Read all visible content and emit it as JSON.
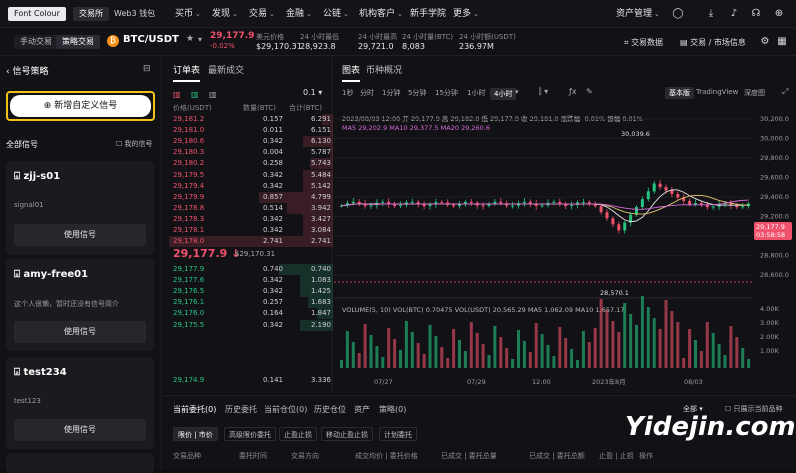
{
  "topbar": {
    "logo": "Font Colour",
    "seg_exchange": "交易所",
    "seg_wallet": "Web3 钱包",
    "nav": [
      "买币",
      "发现",
      "交易",
      "金融",
      "公链",
      "机构客户",
      "新手学院",
      "更多"
    ],
    "asset_mgmt": "资产管理"
  },
  "subbar": {
    "manual": "手动交易",
    "strategy": "策略交易",
    "pair": "BTC/USDT",
    "price": "29,177.9",
    "change": "-0.02%",
    "usd_label": "美元价格",
    "usd_value": "$29,170.31",
    "high_label": "24 小时最低",
    "high_value": "28,923.8",
    "low_label": "24 小时最高",
    "low_value": "29,721.0",
    "vol_label": "24 小时量(BTC)",
    "vol_value": "8,083",
    "amt_label": "24 小时额(USDT)",
    "amt_value": "236.97M",
    "trade_data": "交易数据",
    "trade_info": "交易 / 市场信息"
  },
  "left": {
    "title": "信号策略",
    "add": "新增自定义信号",
    "all": "全部信号",
    "mine": "我的信号",
    "cards": [
      {
        "name": "zjj-s01",
        "desc": "signal01",
        "use": "使用信号"
      },
      {
        "name": "amy-free01",
        "desc": "这个人很懒，暂时还没有信号简介",
        "use": "使用信号"
      },
      {
        "name": "test234",
        "desc": "test123",
        "use": "使用信号"
      }
    ]
  },
  "orderbook": {
    "tab_book": "订单表",
    "tab_trades": "最新成交",
    "precision": "0.1",
    "hdr_price": "价格(USDT)",
    "hdr_qty": "数量(BTC)",
    "hdr_total": "合计(BTC)",
    "asks": [
      [
        "29,181.2",
        "0.157",
        "6.291",
        0.07
      ],
      [
        "29,181.0",
        "0.011",
        "6.151",
        0.02
      ],
      [
        "29,180.6",
        "0.342",
        "6.130",
        0.18
      ],
      [
        "29,180.3",
        "0.004",
        "5.787",
        0.02
      ],
      [
        "29,180.2",
        "0.258",
        "5.743",
        0.14
      ],
      [
        "29,179.5",
        "0.342",
        "5.484",
        0.18
      ],
      [
        "29,179.4",
        "0.342",
        "5.142",
        0.18
      ],
      [
        "29,179.9",
        "0.857",
        "4.799",
        0.45
      ],
      [
        "29,178.8",
        "0.514",
        "3.942",
        0.28
      ],
      [
        "29,178.3",
        "0.342",
        "3.427",
        0.18
      ],
      [
        "29,178.1",
        "0.342",
        "3.084",
        0.18
      ],
      [
        "29,178.0",
        "2.741",
        "2.741",
        1.0
      ]
    ],
    "mid_price": "29,177.9",
    "mid_arrow": "↓",
    "mid_usd": "$29,170.31",
    "bids": [
      [
        "29,177.9",
        "0.740",
        "0.740",
        0.33
      ],
      [
        "29,177.6",
        "0.342",
        "1.083",
        0.2
      ],
      [
        "29,176.5",
        "0.342",
        "1.425",
        0.2
      ],
      [
        "29,176.1",
        "0.257",
        "1.683",
        0.15
      ],
      [
        "29,176.0",
        "0.164",
        "1.847",
        0.1
      ],
      [
        "29,175.5",
        "0.342",
        "2.190",
        0.2
      ]
    ],
    "last_bid": [
      "29,174.9",
      "0.141",
      "3.336"
    ]
  },
  "chart": {
    "tab_chart": "图表",
    "tab_overview": "币种概况",
    "timeframes": [
      "1秒",
      "分时",
      "1分钟",
      "5分钟",
      "15分钟",
      "1小时",
      "4小时"
    ],
    "views": [
      "基本版",
      "TradingView",
      "深度图"
    ],
    "ohlc": "2023/08/03 12:00  开 29,177.9  高 29,182.0  低 29,177.9  收 29,181.0  涨跌幅 -0.01%  振幅 0.01%",
    "ma_line": "MA5 29,202.9  MA10 29,377.5  MA20 29,260.6",
    "vol_line": "VOLUME(5, 10)  VOL(BTC) 0.70475  VOL(USDT) 20,565.29  MA5 1,062.09  MA10 1,657.17",
    "hi_marker": "30,039.6",
    "lo_marker": "28,570.1",
    "price_ticks": [
      "30,200.0",
      "30,000.0",
      "29,800.0",
      "29,600.0",
      "29,400.0",
      "29,200.0",
      "29,000.0",
      "28,800.0",
      "28,600.0"
    ],
    "cur_price": "29,177.9",
    "countdown": "03:58:58",
    "vol_ticks": [
      "4.00K",
      "3.00K",
      "2.00K",
      "1.00K"
    ],
    "time_ticks": [
      "07/27",
      "07/29",
      "12:00",
      "2023年8月",
      "08/03"
    ],
    "colors": {
      "up": "#25c481",
      "down": "#f0516b",
      "ma5": "#e8e8ea",
      "ma10": "#e6c46f",
      "ma20": "#d56ad9"
    }
  },
  "bottom": {
    "tabs": [
      "当前委托(0)",
      "历史委托",
      "当前仓位(0)",
      "历史仓位",
      "资产",
      "策略(0)"
    ],
    "all": "全部",
    "current_only": "只展示当前品种",
    "pills": [
      "限价 | 市价",
      "高级限价委托",
      "止盈止损",
      "移动止盈止损",
      "计划委托"
    ],
    "headers": [
      "交易品种",
      "委托时间",
      "交易方向",
      "成交均价 | 委托价格",
      "已成交 | 委托总量",
      "已成交 | 委托总额",
      "止盈 | 止损",
      "操作"
    ]
  },
  "watermark": "Yidejin.com"
}
